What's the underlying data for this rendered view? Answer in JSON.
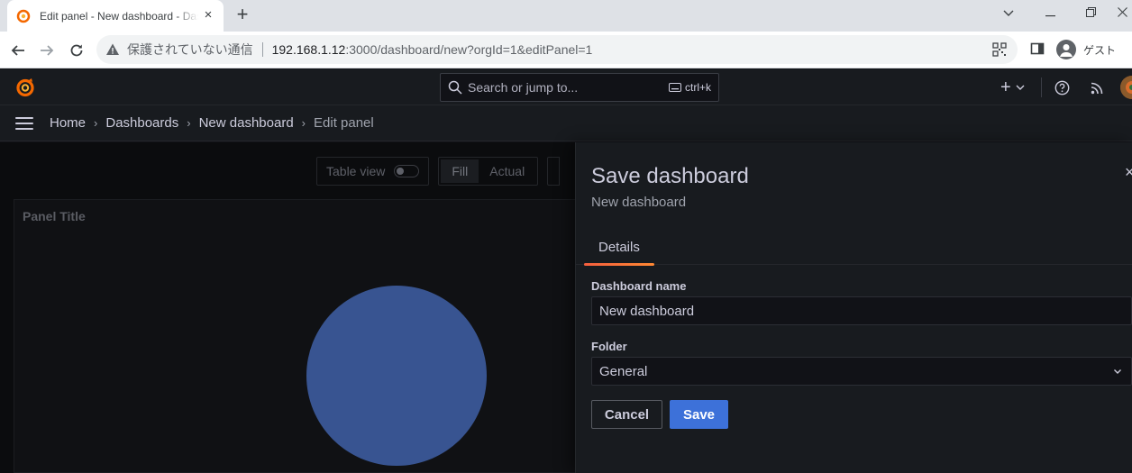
{
  "browser": {
    "tab_title": "Edit panel - New dashboard - Dashboards - Grafana",
    "new_tab_symbol": "+",
    "tab_close_symbol": "×",
    "security_label": "保護されていない通信",
    "url_host": "192.168.1.12",
    "url_rest": ":3000/dashboard/new?orgId=1&editPanel=1",
    "profile_label": "ゲスト"
  },
  "grafana": {
    "search_placeholder": "Search or jump to...",
    "search_shortcut": "ctrl+k",
    "add_symbol": "+",
    "breadcrumbs": [
      "Home",
      "Dashboards",
      "New dashboard",
      "Edit panel"
    ],
    "breadcrumb_separator": "›",
    "editor": {
      "table_view_label": "Table view",
      "fill_label": "Fill",
      "actual_label": "Actual",
      "panel_title": "Panel Title"
    },
    "save_drawer": {
      "title": "Save dashboard",
      "subtitle": "New dashboard",
      "close_symbol": "×",
      "tab_details": "Details",
      "dashboard_name_label": "Dashboard name",
      "dashboard_name_value": "New dashboard",
      "folder_label": "Folder",
      "folder_value": "General",
      "cancel_label": "Cancel",
      "save_label": "Save"
    }
  },
  "colors": {
    "grafana_bg": "#111217",
    "grafana_panel": "#181b1f",
    "primary_button": "#3d71d9",
    "tab_underline": "#f55f3e",
    "pie_fill": "#3b5998"
  }
}
